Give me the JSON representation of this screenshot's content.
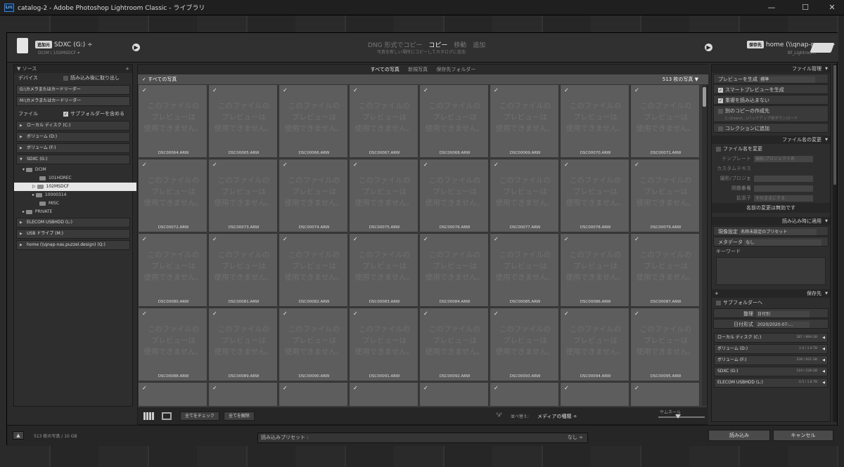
{
  "window": {
    "title": "catalog-2 - Adobe Photoshop Lightroom Classic - ライブラリ",
    "app_icon": "Lrc",
    "min": "—",
    "max": "☐",
    "close": "✕"
  },
  "header": {
    "source_tag": "追加元",
    "source_name": "SDXC (G:) ÷",
    "source_path": "DCIM \\ 102MSDCF ▾",
    "modes": [
      "DNG 形式でコピー",
      "コピー",
      "移動",
      "追加"
    ],
    "mode_subtitle": "写真を新しい場所にコピーしてカタログに追加",
    "dest_tag": "保存先",
    "dest_name": "home (\\\\qnap-nas... ÷",
    "dest_sub": "Bf_Lightroom"
  },
  "left": {
    "source_header": "ソース",
    "device_label": "デバイス",
    "eject_after": "読み込み後に取り出し",
    "card_g": "G:\\カメラまたはカードリーダー",
    "card_m": "M:\\カメラまたはカードリーダー",
    "files_label": "ファイル",
    "include_subfolders": "サブフォルダーを含める",
    "volumes_top": [
      "ローカル ディスク (C:)",
      "ボリューム (D:)",
      "ボリューム (F:)",
      "SDXC (G:)"
    ],
    "folders": [
      "DCIM",
      "101HDREC",
      "102MSDCF",
      "10000314",
      "MISC",
      "PRIVATE"
    ],
    "volumes_bottom": [
      "ELECOM USBHDD (L:)",
      "USB ドライブ (M:)",
      "home (\\\\qnap-nas.puzzel.design) (Q:)"
    ]
  },
  "center": {
    "view_tabs": [
      "すべての写真",
      "新規写真",
      "保存先フォルダー"
    ],
    "all_photos": "すべての写真",
    "count": "513 枚の写真",
    "no_preview": [
      "このファイルの",
      "プレビューは",
      "使用できません。"
    ],
    "filenames": [
      "DSC00064.ARW",
      "DSC00065.ARW",
      "DSC00066.ARW",
      "DSC00067.ARW",
      "DSC00068.ARW",
      "DSC00069.ARW",
      "DSC00070.ARW",
      "DSC00071.ARW",
      "DSC00072.ARW",
      "DSC00073.ARW",
      "DSC00074.ARW",
      "DSC00075.ARW",
      "DSC00076.ARW",
      "DSC00077.ARW",
      "DSC00078.ARW",
      "DSC00079.ARW",
      "DSC00080.ARW",
      "DSC00081.ARW",
      "DSC00082.ARW",
      "DSC00083.ARW",
      "DSC00084.ARW",
      "DSC00085.ARW",
      "DSC00086.ARW",
      "DSC00087.ARW",
      "DSC00088.ARW",
      "DSC00089.ARW",
      "DSC00090.ARW",
      "DSC00091.ARW",
      "DSC00092.ARW",
      "DSC00093.ARW",
      "DSC00094.ARW",
      "DSC00095.ARW"
    ],
    "check_all": "全てをチェック",
    "uncheck_all": "全てを解除",
    "sort_label": "並べ替え:",
    "sort_value": "メディアの種類 ÷",
    "thumb_label": "サムネール"
  },
  "right": {
    "file_mgmt": "ファイル管理",
    "build_previews": "プレビューを生成",
    "preview_value": "標準",
    "smart_preview": "スマートプレビューを生成",
    "no_duplicates": "重複を読み込まない",
    "second_copy": "別のコピーの作成先",
    "second_copy_path": "C:\\Users\\...\\バックアップ用ダウンロード",
    "add_collection": "コレクションに追加",
    "rename_header": "ファイル名の変更",
    "rename_files": "ファイル名を変更",
    "template": "テンプレート",
    "template_value": "撮影/プロジェクト名",
    "custom_text": "カスタムテキスト",
    "shoot_name": "撮影/プロジェクト名",
    "start_number": "開始番号",
    "extension": "拡張子",
    "extension_value": "そのままにする",
    "rename_invalid": "名前の変更は無効です",
    "apply_header": "読み込み時に適用",
    "develop_label": "現像設定",
    "develop_value": "名称未設定のプリセット",
    "metadata_label": "メタデータ",
    "metadata_value": "なし",
    "keywords": "キーワード",
    "dest_header": "保存先",
    "into_subfolder": "サブフォルダーへ",
    "organize": "整理",
    "organize_value": "日付別",
    "date_format": "日付形式",
    "date_format_value": "2020/2020-07-...",
    "dest_volumes": [
      {
        "name": "ローカル ディスク (C:)",
        "size": "287 / 894 GB"
      },
      {
        "name": "ボリューム (D:)",
        "size": "1.0 / 1.9 TB"
      },
      {
        "name": "ボリューム (F:)",
        "size": "239 / 931 GB"
      },
      {
        "name": "SDXC (G:)",
        "size": "119 / 238 GB"
      },
      {
        "name": "ELECOM USBHDD (L:)",
        "size": "0.5 / 1.8 TB"
      }
    ]
  },
  "footer": {
    "info": "513 枚の写真 / 10 GB",
    "preset_label": "読み込みプリセット :",
    "preset_value": "なし ÷",
    "import": "読み込み",
    "cancel": "キャンセル"
  }
}
